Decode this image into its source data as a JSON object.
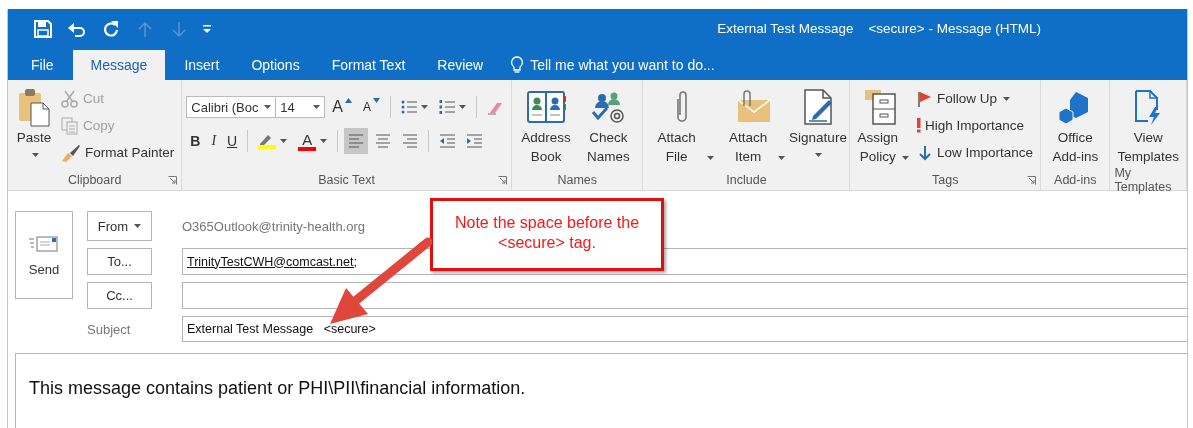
{
  "window": {
    "title": "External Test Message    <secure> - Message (HTML)"
  },
  "quick_access": [
    {
      "kind": "save",
      "disabled": false
    },
    {
      "kind": "undo",
      "disabled": false
    },
    {
      "kind": "redo",
      "disabled": false
    },
    {
      "kind": "up",
      "disabled": true
    },
    {
      "kind": "down",
      "disabled": true
    },
    {
      "kind": "customize",
      "disabled": false
    }
  ],
  "tabs": [
    {
      "label": "File",
      "selected": false
    },
    {
      "label": "Message",
      "selected": true
    },
    {
      "label": "Insert",
      "selected": false
    },
    {
      "label": "Options",
      "selected": false
    },
    {
      "label": "Format Text",
      "selected": false
    },
    {
      "label": "Review",
      "selected": false
    }
  ],
  "tell_me": "Tell me what you want to do...",
  "ribbon": [
    {
      "label": "Clipboard",
      "launcher": true,
      "items": [
        {
          "kind": "split",
          "label": "Paste"
        },
        {
          "kind": "small",
          "label": "Cut",
          "disabled": true
        },
        {
          "kind": "small",
          "label": "Copy",
          "disabled": true
        },
        {
          "kind": "small",
          "label": "Format Painter",
          "disabled": false
        }
      ]
    },
    {
      "label": "Basic Text",
      "launcher": true,
      "lines": [
        {
          "controls": [
            {
              "kind": "combo",
              "value": "Calibri (Boc"
            },
            {
              "kind": "combo",
              "value": "14"
            },
            {
              "kind": "grow",
              "label": "A"
            },
            {
              "kind": "shrink",
              "label": "A"
            },
            {
              "kind": "separator"
            },
            {
              "kind": "icon",
              "dropdown": true
            },
            {
              "kind": "icon",
              "dropdown": true
            },
            {
              "kind": "separator"
            },
            {
              "kind": "icon",
              "dropdown": false
            }
          ]
        },
        {
          "controls": [
            {
              "kind": "letter",
              "label": "B"
            },
            {
              "kind": "letter",
              "label": "I"
            },
            {
              "kind": "letter",
              "label": "U"
            },
            {
              "kind": "separator"
            },
            {
              "kind": "color",
              "color": "#ffff00",
              "dropdown": true
            },
            {
              "kind": "color",
              "label": "A",
              "color": "#ff0000",
              "dropdown": true
            },
            {
              "kind": "separator"
            },
            {
              "kind": "align",
              "selected": true
            },
            {
              "kind": "align",
              "selected": false
            },
            {
              "kind": "align",
              "selected": false
            },
            {
              "kind": "separator"
            },
            {
              "kind": "icon",
              "dropdown": false
            },
            {
              "kind": "icon",
              "dropdown": false
            }
          ]
        }
      ]
    },
    {
      "label": "Names",
      "launcher": false,
      "items": [
        {
          "kind": "large",
          "label": "Address Book"
        },
        {
          "kind": "large",
          "label": "Check Names"
        }
      ]
    },
    {
      "label": "Include",
      "launcher": false,
      "items": [
        {
          "kind": "large",
          "label": "Attach File",
          "dropdown": true
        },
        {
          "kind": "large",
          "label": "Attach Item",
          "dropdown": true
        },
        {
          "kind": "split",
          "label": "Signature"
        }
      ]
    },
    {
      "label": "Tags",
      "launcher": true,
      "items": [
        {
          "kind": "large",
          "label": "Assign Policy",
          "dropdown": true
        },
        {
          "kind": "small",
          "label": "Follow Up",
          "dropdown": true,
          "disabled": false
        },
        {
          "kind": "small",
          "label": "High Importance",
          "disabled": false
        },
        {
          "kind": "small",
          "label": "Low Importance",
          "disabled": false
        }
      ]
    },
    {
      "label": "Add-ins",
      "launcher": false,
      "items": [
        {
          "kind": "large",
          "label": "Office Add-ins"
        }
      ]
    },
    {
      "label": "My Templates",
      "launcher": false,
      "items": [
        {
          "kind": "large",
          "label": "View Templates"
        }
      ]
    }
  ],
  "compose": {
    "send": "Send",
    "from_button": "From",
    "from_address": "O365Outlook@trinity-health.org",
    "to_button": "To...",
    "to": "TrinityTestCWH@comcast.net;",
    "cc_button": "Cc...",
    "subject_label": "Subject",
    "subject": "External Test Message   <secure>"
  },
  "body": "This message contains patient or PHI\\PII\\financial information.",
  "annotation": {
    "text": "Note the space before the <secure> tag."
  }
}
